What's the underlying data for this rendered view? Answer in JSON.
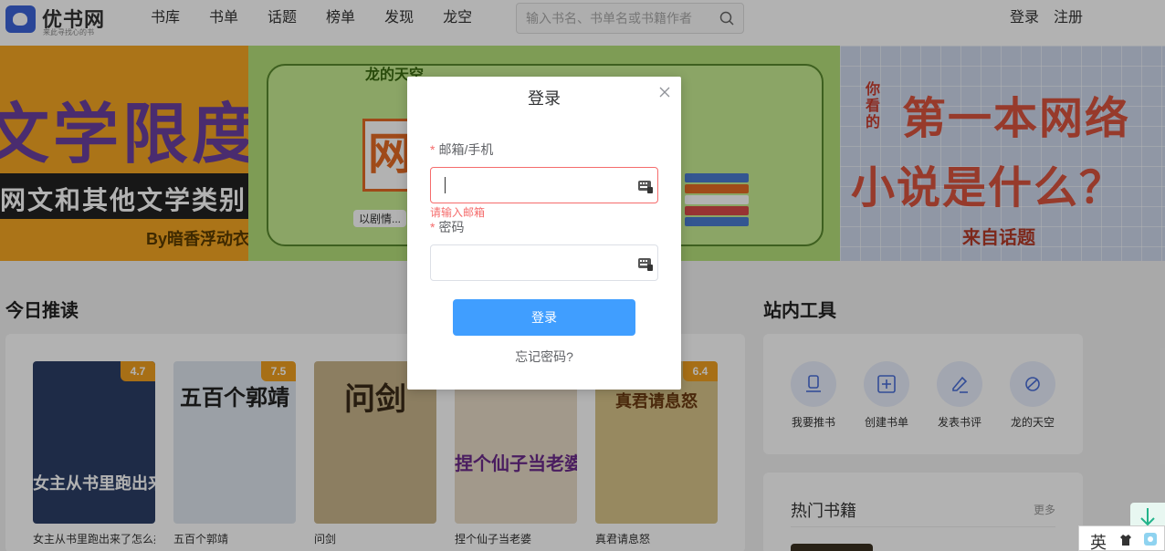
{
  "header": {
    "logo_text": "优书网",
    "logo_sub": "来此寻找心的书",
    "nav": [
      "书库",
      "书单",
      "话题",
      "榜单",
      "发现",
      "龙空"
    ],
    "search_placeholder": "输入书名、书单名或书籍作者",
    "login": "登录",
    "register": "注册"
  },
  "banner": {
    "slide1": {
      "title": "文学限度",
      "subtitle": "网文和其他文学类别",
      "by": "By暗香浮动衣"
    },
    "slide2": {
      "logo": "龙的天空",
      "big_char": "网",
      "tag": "以剧情..."
    },
    "slide3": {
      "you": "你看的",
      "line1": "第一本网络",
      "line2": "小说是什么？",
      "source": "来自话题"
    }
  },
  "today": {
    "title": "今日推读",
    "books": [
      {
        "name": "女主从书里跑出来了怎么办",
        "score": "4.7",
        "cover_text": "女主从书里跑出来了",
        "bg": "#2c3e66",
        "fg": "#ffffff"
      },
      {
        "name": "五百个郭靖",
        "score": "7.5",
        "cover_text": "五百个郭靖",
        "bg": "#dfe6ee",
        "fg": "#222222"
      },
      {
        "name": "问剑",
        "score": "",
        "cover_text": "问剑",
        "bg": "#c9b58c",
        "fg": "#3a2a18"
      },
      {
        "name": "捏个仙子当老婆",
        "score": "",
        "cover_text": "捏个仙子当老婆",
        "bg": "#e8dcc8",
        "fg": "#6a2a8a"
      },
      {
        "name": "真君请息怒",
        "score": "6.4",
        "cover_text": "真君请息怒",
        "bg": "#d9c58a",
        "fg": "#6a3a10"
      }
    ]
  },
  "tools": {
    "title": "站内工具",
    "items": [
      "我要推书",
      "创建书单",
      "发表书评",
      "龙的天空"
    ]
  },
  "hot": {
    "title": "热门书籍",
    "more": "更多"
  },
  "modal": {
    "title": "登录",
    "email_label": "邮箱/手机",
    "email_value": "",
    "email_error": "请输入邮箱",
    "password_label": "密码",
    "password_value": "",
    "submit": "登录",
    "forgot": "忘记密码?"
  },
  "ime": {
    "lang": "英"
  }
}
